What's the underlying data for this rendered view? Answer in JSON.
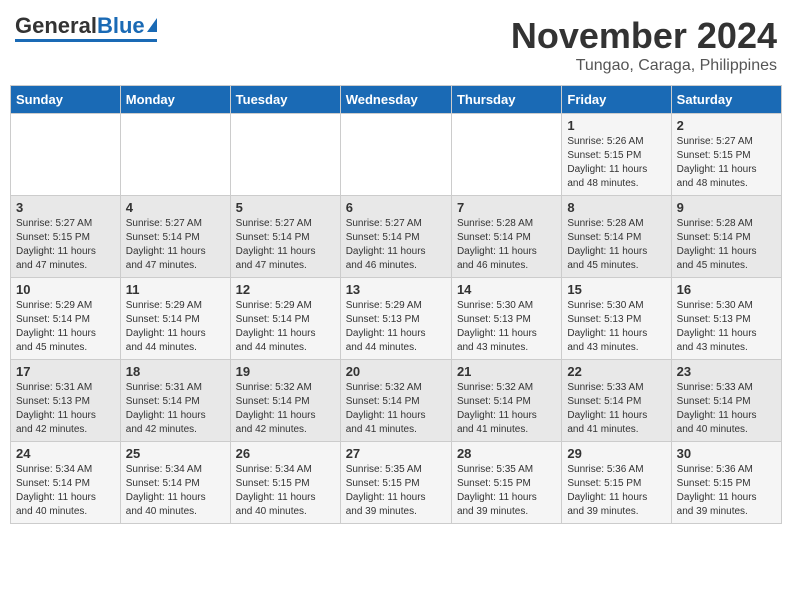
{
  "header": {
    "logo_general": "General",
    "logo_blue": "Blue",
    "month_title": "November 2024",
    "location": "Tungao, Caraga, Philippines"
  },
  "calendar": {
    "days_of_week": [
      "Sunday",
      "Monday",
      "Tuesday",
      "Wednesday",
      "Thursday",
      "Friday",
      "Saturday"
    ],
    "weeks": [
      [
        {
          "day": "",
          "info": ""
        },
        {
          "day": "",
          "info": ""
        },
        {
          "day": "",
          "info": ""
        },
        {
          "day": "",
          "info": ""
        },
        {
          "day": "",
          "info": ""
        },
        {
          "day": "1",
          "info": "Sunrise: 5:26 AM\nSunset: 5:15 PM\nDaylight: 11 hours\nand 48 minutes."
        },
        {
          "day": "2",
          "info": "Sunrise: 5:27 AM\nSunset: 5:15 PM\nDaylight: 11 hours\nand 48 minutes."
        }
      ],
      [
        {
          "day": "3",
          "info": "Sunrise: 5:27 AM\nSunset: 5:15 PM\nDaylight: 11 hours\nand 47 minutes."
        },
        {
          "day": "4",
          "info": "Sunrise: 5:27 AM\nSunset: 5:14 PM\nDaylight: 11 hours\nand 47 minutes."
        },
        {
          "day": "5",
          "info": "Sunrise: 5:27 AM\nSunset: 5:14 PM\nDaylight: 11 hours\nand 47 minutes."
        },
        {
          "day": "6",
          "info": "Sunrise: 5:27 AM\nSunset: 5:14 PM\nDaylight: 11 hours\nand 46 minutes."
        },
        {
          "day": "7",
          "info": "Sunrise: 5:28 AM\nSunset: 5:14 PM\nDaylight: 11 hours\nand 46 minutes."
        },
        {
          "day": "8",
          "info": "Sunrise: 5:28 AM\nSunset: 5:14 PM\nDaylight: 11 hours\nand 45 minutes."
        },
        {
          "day": "9",
          "info": "Sunrise: 5:28 AM\nSunset: 5:14 PM\nDaylight: 11 hours\nand 45 minutes."
        }
      ],
      [
        {
          "day": "10",
          "info": "Sunrise: 5:29 AM\nSunset: 5:14 PM\nDaylight: 11 hours\nand 45 minutes."
        },
        {
          "day": "11",
          "info": "Sunrise: 5:29 AM\nSunset: 5:14 PM\nDaylight: 11 hours\nand 44 minutes."
        },
        {
          "day": "12",
          "info": "Sunrise: 5:29 AM\nSunset: 5:14 PM\nDaylight: 11 hours\nand 44 minutes."
        },
        {
          "day": "13",
          "info": "Sunrise: 5:29 AM\nSunset: 5:13 PM\nDaylight: 11 hours\nand 44 minutes."
        },
        {
          "day": "14",
          "info": "Sunrise: 5:30 AM\nSunset: 5:13 PM\nDaylight: 11 hours\nand 43 minutes."
        },
        {
          "day": "15",
          "info": "Sunrise: 5:30 AM\nSunset: 5:13 PM\nDaylight: 11 hours\nand 43 minutes."
        },
        {
          "day": "16",
          "info": "Sunrise: 5:30 AM\nSunset: 5:13 PM\nDaylight: 11 hours\nand 43 minutes."
        }
      ],
      [
        {
          "day": "17",
          "info": "Sunrise: 5:31 AM\nSunset: 5:13 PM\nDaylight: 11 hours\nand 42 minutes."
        },
        {
          "day": "18",
          "info": "Sunrise: 5:31 AM\nSunset: 5:14 PM\nDaylight: 11 hours\nand 42 minutes."
        },
        {
          "day": "19",
          "info": "Sunrise: 5:32 AM\nSunset: 5:14 PM\nDaylight: 11 hours\nand 42 minutes."
        },
        {
          "day": "20",
          "info": "Sunrise: 5:32 AM\nSunset: 5:14 PM\nDaylight: 11 hours\nand 41 minutes."
        },
        {
          "day": "21",
          "info": "Sunrise: 5:32 AM\nSunset: 5:14 PM\nDaylight: 11 hours\nand 41 minutes."
        },
        {
          "day": "22",
          "info": "Sunrise: 5:33 AM\nSunset: 5:14 PM\nDaylight: 11 hours\nand 41 minutes."
        },
        {
          "day": "23",
          "info": "Sunrise: 5:33 AM\nSunset: 5:14 PM\nDaylight: 11 hours\nand 40 minutes."
        }
      ],
      [
        {
          "day": "24",
          "info": "Sunrise: 5:34 AM\nSunset: 5:14 PM\nDaylight: 11 hours\nand 40 minutes."
        },
        {
          "day": "25",
          "info": "Sunrise: 5:34 AM\nSunset: 5:14 PM\nDaylight: 11 hours\nand 40 minutes."
        },
        {
          "day": "26",
          "info": "Sunrise: 5:34 AM\nSunset: 5:15 PM\nDaylight: 11 hours\nand 40 minutes."
        },
        {
          "day": "27",
          "info": "Sunrise: 5:35 AM\nSunset: 5:15 PM\nDaylight: 11 hours\nand 39 minutes."
        },
        {
          "day": "28",
          "info": "Sunrise: 5:35 AM\nSunset: 5:15 PM\nDaylight: 11 hours\nand 39 minutes."
        },
        {
          "day": "29",
          "info": "Sunrise: 5:36 AM\nSunset: 5:15 PM\nDaylight: 11 hours\nand 39 minutes."
        },
        {
          "day": "30",
          "info": "Sunrise: 5:36 AM\nSunset: 5:15 PM\nDaylight: 11 hours\nand 39 minutes."
        }
      ]
    ]
  }
}
